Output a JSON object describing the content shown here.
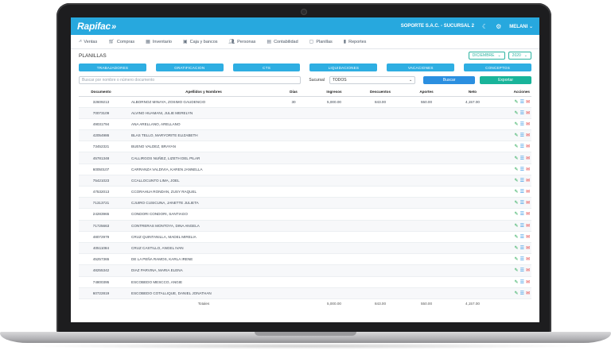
{
  "app": {
    "logo": "Rapifac",
    "company": "SOPORTE S.A.C. - SUCURSAL 2",
    "user": "MELANI"
  },
  "menu": [
    {
      "label": "Ventas",
      "icon": "chart-icon"
    },
    {
      "label": "Compras",
      "icon": "cart-icon"
    },
    {
      "label": "Inventario",
      "icon": "boxes-icon"
    },
    {
      "label": "Caja y bancos",
      "icon": "cash-icon"
    },
    {
      "label": "Personas",
      "icon": "people-icon"
    },
    {
      "label": "Contabilidad",
      "icon": "calculator-icon"
    },
    {
      "label": "Planillas",
      "icon": "document-icon"
    },
    {
      "label": "Reportes",
      "icon": "report-icon"
    }
  ],
  "page": {
    "title": "PLANILLAS",
    "month": "DICIEMBRE",
    "year": "2020"
  },
  "tabs": [
    "TRABAJADORES",
    "GRATIFICACION",
    "CTS",
    "LIQUIDACIONES",
    "VACACIONES",
    "CONCEPTOS"
  ],
  "search": {
    "placeholder": "Buscar por nombre o número documento",
    "sucursal_label": "Sucursal",
    "sucursal_value": "TODOS",
    "buscar_label": "Buscar",
    "exportar_label": "Exportar"
  },
  "table": {
    "headers": [
      "Documento",
      "Apellidos y Nombres",
      "Días",
      "Ingresos",
      "Descuentos",
      "Aportes",
      "Neto",
      "Acciones"
    ],
    "rows": [
      {
        "doc": "32609213",
        "name": "ALBORNOZ MINAYA, ZOSIMO GAUDENCIO",
        "dias": "30",
        "ingresos": "5,000.00",
        "descuentos": "843.00",
        "aportes": "550.00",
        "neto": "4,157.00"
      },
      {
        "doc": "70073109",
        "name": "ALVINO HUAMANI, JULIE MERELYN",
        "dias": "",
        "ingresos": "",
        "descuentos": "",
        "aportes": "",
        "neto": ""
      },
      {
        "doc": "49031794",
        "name": "ANA ARELLANO, ARELLANO",
        "dias": "",
        "ingresos": "",
        "descuentos": "",
        "aportes": "",
        "neto": ""
      },
      {
        "doc": "42054986",
        "name": "BLAS TELLO, MARYORITE ELIZABETH",
        "dias": "",
        "ingresos": "",
        "descuentos": "",
        "aportes": "",
        "neto": ""
      },
      {
        "doc": "73452321",
        "name": "BUENO VALDEZ, BRAYAN",
        "dias": "",
        "ingresos": "",
        "descuentos": "",
        "aportes": "",
        "neto": ""
      },
      {
        "doc": "45781348",
        "name": "CALLIRGOS NUÑEZ, LIZETH DEL PILAR",
        "dias": "",
        "ingresos": "",
        "descuentos": "",
        "aportes": "",
        "neto": ""
      },
      {
        "doc": "60050107",
        "name": "CARRANZA VALDIVIA, KAREN JANNELLA",
        "dias": "",
        "ingresos": "",
        "descuentos": "",
        "aportes": "",
        "neto": ""
      },
      {
        "doc": "75421023",
        "name": "CCALLOCUNTO LIMA, JOEL",
        "dias": "",
        "ingresos": "",
        "descuentos": "",
        "aportes": "",
        "neto": ""
      },
      {
        "doc": "47532013",
        "name": "CCORAHUA RONDAN, ZUSY RAQUEL",
        "dias": "",
        "ingresos": "",
        "descuentos": "",
        "aportes": "",
        "neto": ""
      },
      {
        "doc": "71313721",
        "name": "CJUIRO CUSICUNA, JANETTE JULIETA",
        "dias": "",
        "ingresos": "",
        "descuentos": "",
        "aportes": "",
        "neto": ""
      },
      {
        "doc": "24283965",
        "name": "CONDORI CONDORI, SANTIAGO",
        "dias": "",
        "ingresos": "",
        "descuentos": "",
        "aportes": "",
        "neto": ""
      },
      {
        "doc": "71725663",
        "name": "CONTRERAS MONTOYA, DINA ANGELA",
        "dias": "",
        "ingresos": "",
        "descuentos": "",
        "aportes": "",
        "neto": ""
      },
      {
        "doc": "48072979",
        "name": "CRUZ QUINTANILLA, MADEL MIRELIA",
        "dias": "",
        "ingresos": "",
        "descuentos": "",
        "aportes": "",
        "neto": ""
      },
      {
        "doc": "40511084",
        "name": "CRUZ CASTILLO, ANGEL IVAN",
        "dias": "",
        "ingresos": "",
        "descuentos": "",
        "aportes": "",
        "neto": ""
      },
      {
        "doc": "45257365",
        "name": "DE LA PEÑA RAMOS, KARLA IRENE",
        "dias": "",
        "ingresos": "",
        "descuentos": "",
        "aportes": "",
        "neto": ""
      },
      {
        "doc": "48255342",
        "name": "DIAZ PARVINA, MARIA ELENA",
        "dias": "",
        "ingresos": "",
        "descuentos": "",
        "aportes": "",
        "neto": ""
      },
      {
        "doc": "74800395",
        "name": "ESCOBEDO MESCCO, ANGIE",
        "dias": "",
        "ingresos": "",
        "descuentos": "",
        "aportes": "",
        "neto": ""
      },
      {
        "doc": "60722819",
        "name": "ESCOBEDO COTALLIQUE, DANIEL JONATHAN",
        "dias": "",
        "ingresos": "",
        "descuentos": "",
        "aportes": "",
        "neto": ""
      }
    ],
    "totals": {
      "label": "Totales",
      "ingresos": "5,000.00",
      "descuentos": "843.00",
      "aportes": "550.00",
      "neto": "4,157.00"
    }
  },
  "colors": {
    "primary": "#27a8de",
    "buscar": "#2b8fe0",
    "exportar": "#19b49a",
    "edit": "#1aa34a",
    "mail": "#e23b3b"
  }
}
